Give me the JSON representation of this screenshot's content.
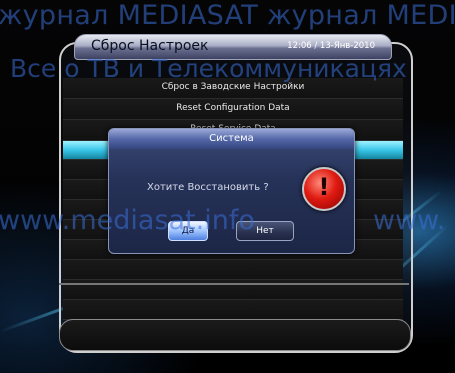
{
  "watermarks": {
    "top": "журнал MEDIASAT     журнал MEDIASAT",
    "middle": "Все о ТВ и Телекоммуникацях",
    "url_left": "www.mediasat.info",
    "url_right": "www."
  },
  "window": {
    "title": "Сброс Настроек",
    "datetime": "12:06 / 13-Янв-2010"
  },
  "menu": {
    "items": [
      "Сброс в Заводские Настройки",
      "Reset Configuration Data",
      "Reset Service Data"
    ]
  },
  "dialog": {
    "title": "Система",
    "message": "Хотите Восстановить ?",
    "yes_label": "Да",
    "no_label": "Нет",
    "alert_glyph": "!"
  },
  "colors": {
    "selection": "#39c6e8",
    "dialog_bg": "#263258",
    "alert": "#e01b12",
    "watermark": "#3a6fd8"
  },
  "icons": {
    "alert": "exclamation-alert-icon"
  }
}
